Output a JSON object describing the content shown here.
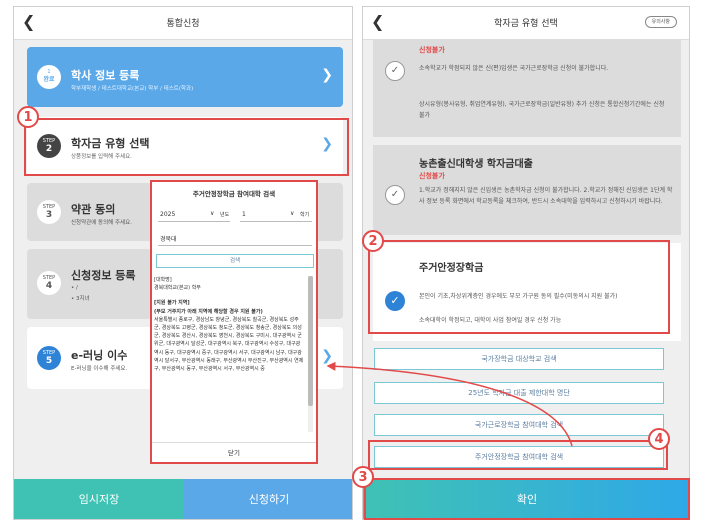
{
  "left_screen": {
    "title": "통합신청",
    "back_icon": "chevron-left-icon",
    "steps": [
      {
        "badge_top": "1",
        "badge_bottom": "완료",
        "title": "학사 정보 등록",
        "subtitle": "학부재학생 / 테스트대학교(본교) 학부 / 테스트(학과)"
      },
      {
        "badge_top": "STEP",
        "badge_bottom": "2",
        "title": "학자금 유형 선택",
        "subtitle": "상품정보를 입력해 주세요."
      },
      {
        "badge_top": "STEP",
        "badge_bottom": "3",
        "title": "약관 동의",
        "subtitle": "신청약관에 동의해 주세요."
      },
      {
        "badge_top": "STEP",
        "badge_bottom": "4",
        "title": "신청정보 등록",
        "subtitle_lines": [
          "• /",
          "• 3지녀"
        ]
      },
      {
        "badge_top": "STEP",
        "badge_bottom": "5",
        "title": "e-러닝 이수",
        "subtitle": "E-러닝을 이수해 주세요."
      }
    ],
    "save_button": "임시저장",
    "apply_button": "신청하기"
  },
  "popup": {
    "title": "주거안정장학금 참여대학 검색",
    "year_value": "2025",
    "year_label": "년도",
    "term_value": "1",
    "term_label": "학기",
    "search_input": "경북대",
    "search_button": "검색",
    "univ_header": "[대학명]",
    "univ_name": "경북대학교(본교) 학부",
    "region_header": "[지원 불가 지역]",
    "region_note": "(부모 거주지가 아래 지역에 해당할 경우 지원 불가)",
    "region_text": "서울특별시 종로구, 경상남도 창녕군, 경상북도 칠곡군, 경상북도 성주군, 경상북도 고령군, 경상북도 청도군, 경상북도 청송군, 경상북도 의성군, 경상북도 경산시, 경상북도 영천시, 경상북도 구미시, 대구광역시 군위군, 대구광역시 달성군, 대구광역시 북구, 대구광역시 수성구, 대구광역시 동구, 대구광역시 중구, 대구광역시 서구, 대구광역시 남구, 대구광역시 달서구, 부산광역시 동래구, 부산광역시 부산진구, 부산광역시 연제구, 부산광역시 동구, 부산광역시 서구, 부산광역시 중",
    "close_button": "닫기"
  },
  "right_screen": {
    "title": "학자금 유형 선택",
    "header_badge": "유의사항",
    "option1": {
      "status": "신청불가",
      "text1": "소속학교가 학점되지 않은 신(편)입생은 국가근로장학금 신청이 불가합니다.",
      "text2": "상시유형(봉사유형, 취업연계유형), 국가근로장학금(일반유형) 추가 신청은 통합신청기간에는 신청 불가"
    },
    "option2": {
      "name": "농촌출신대학생 학자금대출",
      "status": "신청불가",
      "text": "1.학교가 정해지지 않은 신입생은 농촌학자금 신청이 불가합니다. 2.학교가 정해진 신입생은 1단계 학사 정보 등록 화면에서 학교등록을 체크하여, 반드시 소속대학을 입력하시고 신청하시기 바랍니다."
    },
    "option3": {
      "name": "주거안정장학금",
      "text1": "본인이 기초,차상위계층인 경우에도 부모 가구원 동의 필수(미동의시 지원 불가)",
      "text2": "소속대학이 학정되고, 대학이 사업 참여일 경우 신청 가능"
    },
    "links": [
      "국가장학금 대상학교 검색",
      "25년도 학자금 대출 제한대학 명단",
      "국가근로장학금 참여대학 검색",
      "주거안정장학금 참여대학 검색"
    ],
    "confirm_button": "확인"
  },
  "annotations": [
    "1",
    "2",
    "3",
    "4"
  ],
  "colors": {
    "blue": "#5ba8e8",
    "blue_dark": "#2f83d6",
    "teal": "#3fc2b4",
    "red": "#e24a4a",
    "grey_card": "#dcdcdc"
  }
}
